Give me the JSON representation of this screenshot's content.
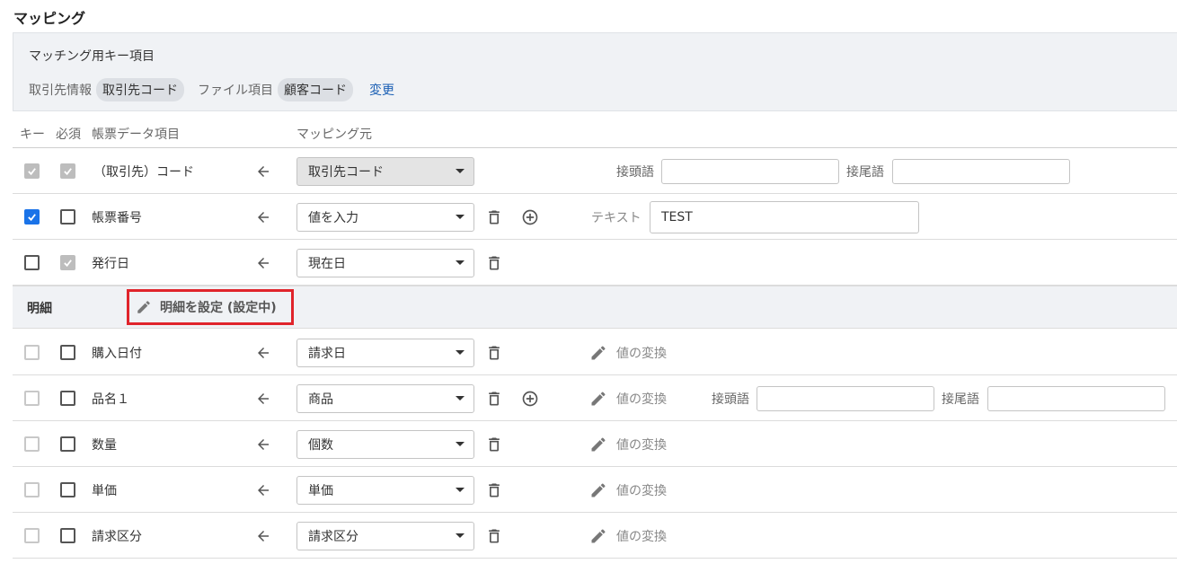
{
  "page": {
    "title": "マッピング"
  },
  "key_panel": {
    "title": "マッチング用キー項目",
    "partner_label": "取引先情報",
    "partner_value": "取引先コード",
    "file_label": "ファイル項目",
    "file_value": "顧客コード",
    "change_link": "変更"
  },
  "headers": {
    "key": "キー",
    "required": "必須",
    "field": "帳票データ項目",
    "source": "マッピング元"
  },
  "labels": {
    "prefix": "接頭語",
    "suffix": "接尾語",
    "text": "テキスト",
    "convert": "値の変換"
  },
  "rows": [
    {
      "field": "（取引先）コード",
      "source": "取引先コード",
      "key": "checked-gray",
      "required": "checked-gray"
    },
    {
      "field": "帳票番号",
      "source": "値を入力",
      "key": "checked",
      "required": "unchecked",
      "text_value": "TEST"
    },
    {
      "field": "発行日",
      "source": "現在日",
      "key": "unchecked",
      "required": "checked-gray"
    }
  ],
  "detail_section": {
    "label": "明細",
    "button_label": "明細を設定 (設定中)"
  },
  "detail_rows": [
    {
      "field": "購入日付",
      "source": "請求日"
    },
    {
      "field": "品名１",
      "source": "商品"
    },
    {
      "field": "数量",
      "source": "個数"
    },
    {
      "field": "単価",
      "source": "単価"
    },
    {
      "field": "請求区分",
      "source": "請求区分"
    }
  ],
  "colors": {
    "accent": "#1a73e8",
    "highlight_border": "#e0242b",
    "link": "#1a5fb4"
  }
}
